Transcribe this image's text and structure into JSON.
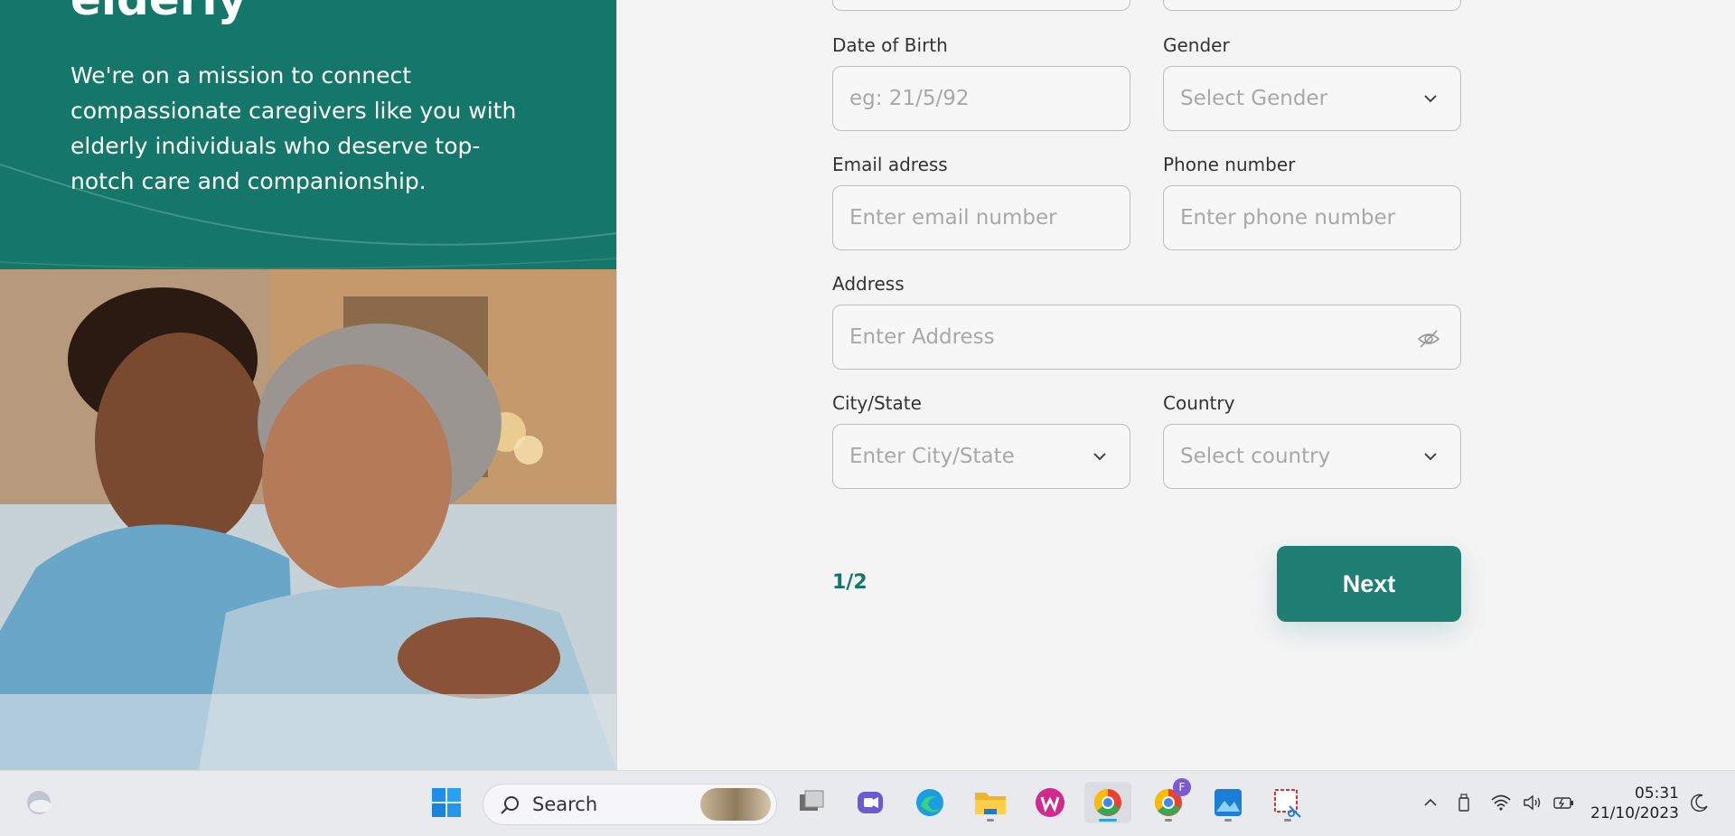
{
  "hero": {
    "heading": "elderly",
    "text": "We're on a mission to connect compassionate caregivers like you with elderly individuals who deserve top-notch care and companionship."
  },
  "form": {
    "dob": {
      "label": "Date of Birth",
      "placeholder": "eg: 21/5/92"
    },
    "gender": {
      "label": "Gender",
      "placeholder": "Select Gender"
    },
    "email": {
      "label": "Email adress",
      "placeholder": "Enter email number"
    },
    "phone": {
      "label": "Phone number",
      "placeholder": "Enter phone number"
    },
    "address": {
      "label": "Address",
      "placeholder": "Enter Address"
    },
    "city": {
      "label": "City/State",
      "placeholder": "Enter City/State"
    },
    "country": {
      "label": "Country",
      "placeholder": "Select country"
    }
  },
  "pager": "1/2",
  "next_label": "Next",
  "taskbar": {
    "search_label": "Search",
    "time": "05:31",
    "date": "21/10/2023",
    "chrome_profile_badge": "F"
  },
  "colors": {
    "brand": "#14776a",
    "button": "#1f7f72"
  }
}
